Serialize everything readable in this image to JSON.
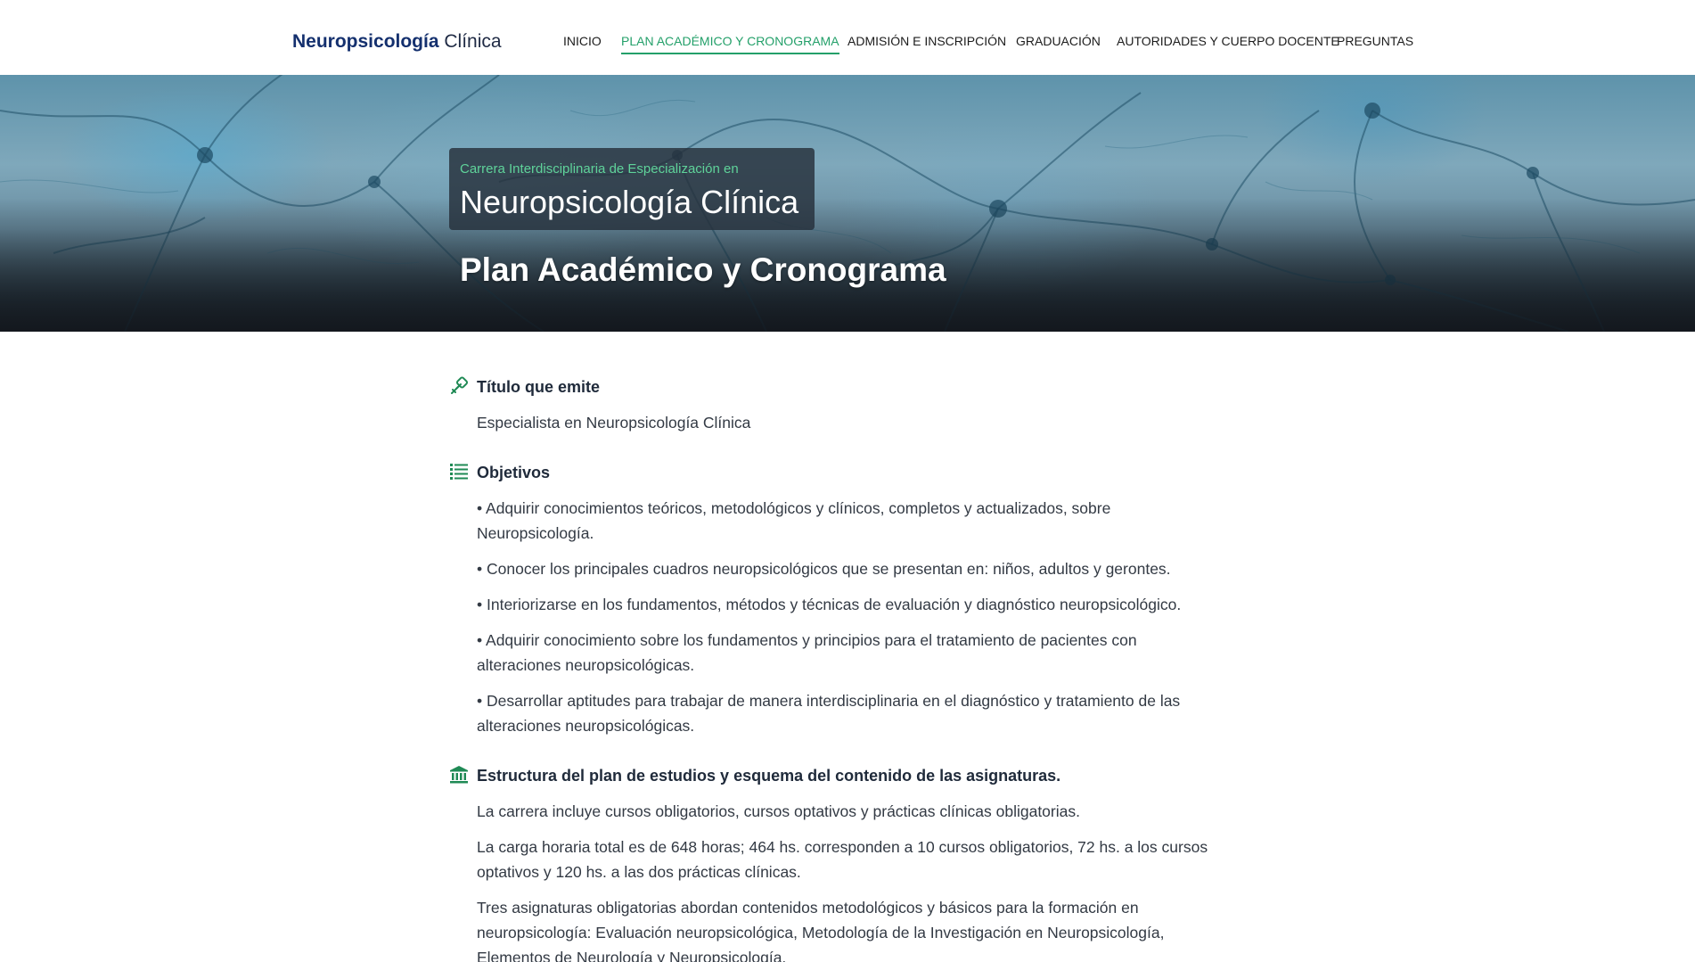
{
  "brand": {
    "strong": "Neuropsicología",
    "light": "Clínica"
  },
  "nav": {
    "items": [
      {
        "label": "INICIO"
      },
      {
        "label": "PLAN ACADÉMICO Y CRONOGRAMA"
      },
      {
        "label": "ADMISIÓN E INSCRIPCIÓN"
      },
      {
        "label": "GRADUACIÓN"
      },
      {
        "label": "AUTORIDADES Y CUERPO DOCENTE"
      },
      {
        "label": "PREGUNTAS"
      }
    ],
    "active_index": 1
  },
  "hero": {
    "eyebrow": "Carrera Interdisciplinaria de Especialización en",
    "title": "Neuropsicología Clínica",
    "subtitle": "Plan Académico y Cronograma"
  },
  "sections": {
    "titulo": {
      "icon": "diploma-icon",
      "heading": "Título que emite",
      "text": "Especialista en Neuropsicología Clínica"
    },
    "objetivos": {
      "icon": "list-icon",
      "heading": "Objetivos",
      "items": [
        "• Adquirir conocimientos teóricos, metodológicos y clínicos, completos y actualizados, sobre Neuropsicología.",
        "• Conocer los principales cuadros neuropsicológicos que se presentan en: niños, adultos y gerontes.",
        "• Interiorizarse en los fundamentos, métodos y técnicas de evaluación y diagnóstico neuropsicológico.",
        "• Adquirir conocimiento sobre los fundamentos y principios para el tratamiento de pacientes con alteraciones neuropsicológicas.",
        "• Desarrollar aptitudes para trabajar de manera interdisciplinaria en el diagnóstico y tratamiento de las alteraciones neuropsicológicas."
      ]
    },
    "estructura": {
      "icon": "institution-icon",
      "heading": "Estructura del plan de estudios y esquema del contenido de las asignaturas.",
      "paragraphs": [
        "La carrera incluye cursos obligatorios, cursos optativos y prácticas clínicas obligatorias.",
        "La carga horaria total es de 648 horas; 464 hs. corresponden a 10 cursos obligatorios, 72 hs. a los cursos optativos y 120 hs. a las dos prácticas clínicas.",
        "Tres asignaturas obligatorias abordan contenidos metodológicos y básicos para la formación en neuropsicología: Evaluación neuropsicológica, Metodología de la Investigación en Neuropsicología, Elementos de Neurología y Neuropsicología."
      ]
    }
  },
  "colors": {
    "accent": "#24a06a",
    "brand": "#14306e",
    "eyebrow": "#5fd39a"
  }
}
